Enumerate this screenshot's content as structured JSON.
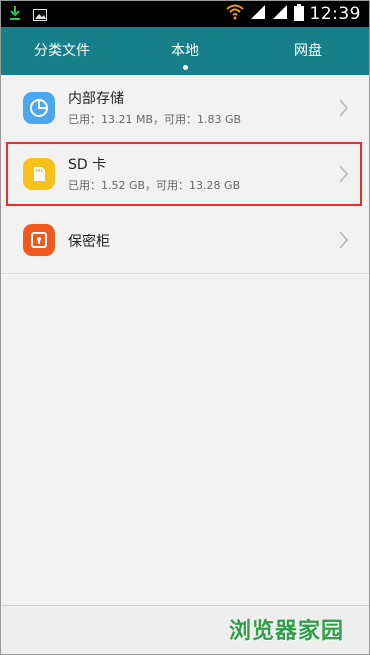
{
  "status_bar": {
    "time": "12:39"
  },
  "tabs": [
    {
      "label": "分类文件"
    },
    {
      "label": "本地",
      "active": true
    },
    {
      "label": "网盘"
    }
  ],
  "storage_items": [
    {
      "title": "内部存储",
      "subtitle": "已用：13.21 MB，可用：1.83 GB",
      "icon": "pie-chart-icon",
      "color": "#4aa7f0"
    },
    {
      "title": "SD 卡",
      "subtitle": "已用：1.52 GB，可用：13.28 GB",
      "icon": "sd-card-icon",
      "color": "#f6c21a"
    },
    {
      "title": "保密柜",
      "subtitle": "",
      "icon": "safe-icon",
      "color": "#f05a1e"
    }
  ],
  "watermark": "浏览器家园",
  "colors": {
    "tab_bar": "#167f8a",
    "highlight": "#e03030"
  }
}
